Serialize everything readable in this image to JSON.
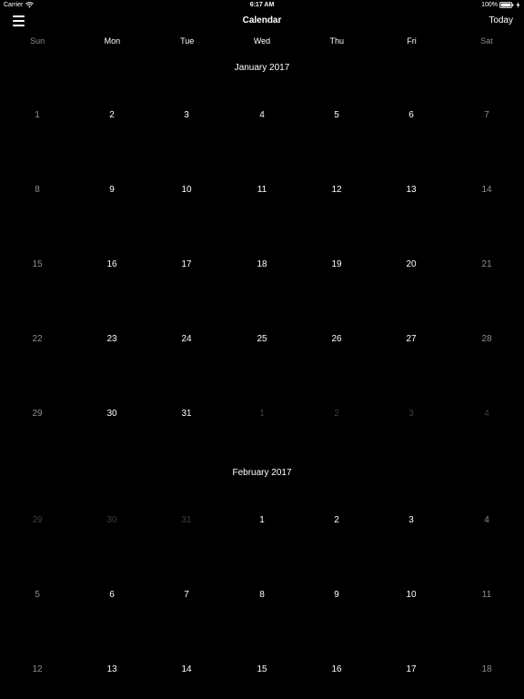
{
  "status_bar": {
    "carrier": "Carrier",
    "time": "6:17 AM",
    "battery": "100%",
    "icons": [
      "wifi-icon",
      "battery-icon",
      "charging-icon"
    ]
  },
  "nav": {
    "title": "Calendar",
    "today_label": "Today",
    "menu_icon": "hamburger-menu-icon"
  },
  "weekdays": [
    "Sun",
    "Mon",
    "Tue",
    "Wed",
    "Thu",
    "Fri",
    "Sat"
  ],
  "colors": {
    "background": "#000000",
    "text": "#ffffff",
    "weekend_text": "#8e8e8e",
    "outside_month_text": "#3e3e3e"
  },
  "months": [
    {
      "title": "January 2017",
      "weeks": [
        [
          {
            "day": "1",
            "outside": false
          },
          {
            "day": "2",
            "outside": false
          },
          {
            "day": "3",
            "outside": false
          },
          {
            "day": "4",
            "outside": false
          },
          {
            "day": "5",
            "outside": false
          },
          {
            "day": "6",
            "outside": false
          },
          {
            "day": "7",
            "outside": false
          }
        ],
        [
          {
            "day": "8",
            "outside": false
          },
          {
            "day": "9",
            "outside": false
          },
          {
            "day": "10",
            "outside": false
          },
          {
            "day": "11",
            "outside": false
          },
          {
            "day": "12",
            "outside": false
          },
          {
            "day": "13",
            "outside": false
          },
          {
            "day": "14",
            "outside": false
          }
        ],
        [
          {
            "day": "15",
            "outside": false
          },
          {
            "day": "16",
            "outside": false
          },
          {
            "day": "17",
            "outside": false
          },
          {
            "day": "18",
            "outside": false
          },
          {
            "day": "19",
            "outside": false
          },
          {
            "day": "20",
            "outside": false
          },
          {
            "day": "21",
            "outside": false
          }
        ],
        [
          {
            "day": "22",
            "outside": false
          },
          {
            "day": "23",
            "outside": false
          },
          {
            "day": "24",
            "outside": false
          },
          {
            "day": "25",
            "outside": false
          },
          {
            "day": "26",
            "outside": false
          },
          {
            "day": "27",
            "outside": false
          },
          {
            "day": "28",
            "outside": false
          }
        ],
        [
          {
            "day": "29",
            "outside": false
          },
          {
            "day": "30",
            "outside": false
          },
          {
            "day": "31",
            "outside": false
          },
          {
            "day": "1",
            "outside": true
          },
          {
            "day": "2",
            "outside": true
          },
          {
            "day": "3",
            "outside": true
          },
          {
            "day": "4",
            "outside": true
          }
        ]
      ]
    },
    {
      "title": "February 2017",
      "weeks": [
        [
          {
            "day": "29",
            "outside": true
          },
          {
            "day": "30",
            "outside": true
          },
          {
            "day": "31",
            "outside": true
          },
          {
            "day": "1",
            "outside": false
          },
          {
            "day": "2",
            "outside": false
          },
          {
            "day": "3",
            "outside": false
          },
          {
            "day": "4",
            "outside": false
          }
        ],
        [
          {
            "day": "5",
            "outside": false
          },
          {
            "day": "6",
            "outside": false
          },
          {
            "day": "7",
            "outside": false
          },
          {
            "day": "8",
            "outside": false
          },
          {
            "day": "9",
            "outside": false
          },
          {
            "day": "10",
            "outside": false
          },
          {
            "day": "11",
            "outside": false
          }
        ],
        [
          {
            "day": "12",
            "outside": false
          },
          {
            "day": "13",
            "outside": false
          },
          {
            "day": "14",
            "outside": false
          },
          {
            "day": "15",
            "outside": false
          },
          {
            "day": "16",
            "outside": false
          },
          {
            "day": "17",
            "outside": false
          },
          {
            "day": "18",
            "outside": false
          }
        ]
      ]
    }
  ]
}
